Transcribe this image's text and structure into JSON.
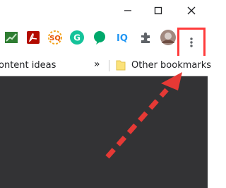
{
  "window": {
    "minimize_glyph": "—",
    "maximize_glyph": "☐",
    "close_glyph": "✕"
  },
  "extensions": [
    {
      "name": "chart-extension-icon",
      "color": "#2e7d32"
    },
    {
      "name": "acrobat-extension-icon",
      "color": "#b30b00"
    },
    {
      "name": "seo-quake-extension-icon",
      "color": "#f4a623",
      "text": "SQ"
    },
    {
      "name": "grammarly-extension-icon",
      "color": "#15c39a",
      "text": "G"
    },
    {
      "name": "chat-extension-icon",
      "color": "#00a86b"
    },
    {
      "name": "iq-extension-icon",
      "color": "#2196f3",
      "text": "IQ"
    },
    {
      "name": "extensions-puzzle-icon",
      "color": "#5f6368"
    },
    {
      "name": "profile-avatar",
      "color": "#8d6e63"
    }
  ],
  "menu": {
    "glyph": "⋮",
    "icon": "three-dot-menu-icon"
  },
  "bookmarks": {
    "left_item": "ontent ideas",
    "overflow": "»",
    "other": "Other bookmarks"
  },
  "colors": {
    "highlight": "#ff3b3b",
    "content_bg": "#333335",
    "arrow": "#e53935"
  }
}
